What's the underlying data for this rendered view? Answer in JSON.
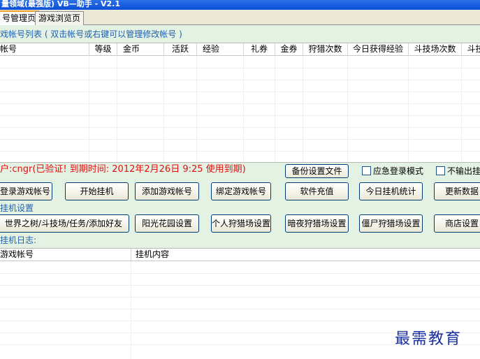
{
  "window": {
    "title": "量领域(最强版)   VB—助手 - V2.1"
  },
  "tabs": [
    {
      "label": "号管理页",
      "active": true
    },
    {
      "label": "游戏浏览页",
      "active": false
    }
  ],
  "account_list": {
    "label": "戏帐号列表 ( 双击帐号或右键可以管理修改帐号 )",
    "columns": [
      "帐号",
      "等级",
      "金币",
      "活跃",
      "经验",
      "礼券",
      "金券",
      "狩猎次数",
      "今日获得经验",
      "斗技场次数",
      "斗技"
    ]
  },
  "status": {
    "text": "户:cngr(已验证! 到期时间: 2012年2月26日 9:25 使用到期)"
  },
  "backup_button": "备份设置文件",
  "options": {
    "emergency_login": "应急登录模式",
    "no_output": "不输出挂"
  },
  "action_buttons": [
    "登录游戏帐号",
    "开始挂机",
    "添加游戏帐号",
    "绑定游戏帐号",
    "软件充值",
    "今日挂机统计",
    "更新数据"
  ],
  "hang_settings": {
    "label": "挂机设置",
    "buttons": [
      "世界之树/斗技场/任务/添加好友",
      "阳光花园设置",
      "个人狩猎场设置",
      "暗夜狩猎场设置",
      "僵尸狩猎场设置",
      "商店设置"
    ]
  },
  "log": {
    "label": "挂机日志:",
    "columns": [
      "游戏帐号",
      "挂机内容"
    ]
  },
  "watermark": "最需教育",
  "colors": {
    "panel_background": "#e4f2e4",
    "status_red": "#e01010",
    "section_blue": "#1f5fb0",
    "tab_highlight": "#f2a12a"
  }
}
